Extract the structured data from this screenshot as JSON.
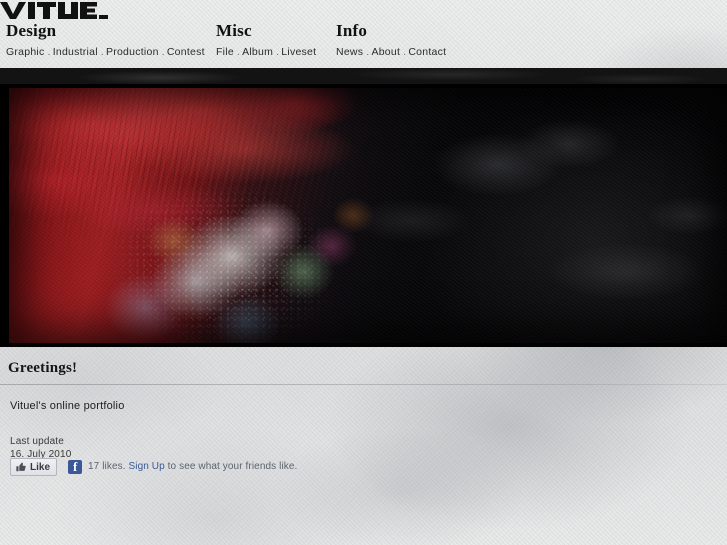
{
  "site": {
    "logo_text": "VITUEL",
    "logo_alt": "vituel-wordmark"
  },
  "nav": {
    "columns": [
      {
        "title": "Design",
        "items": [
          "Graphic",
          "Industrial",
          "Production",
          "Contest"
        ]
      },
      {
        "title": "Misc",
        "items": [
          "File",
          "Album",
          "Liveset"
        ]
      },
      {
        "title": "Info",
        "items": [
          "News",
          "About",
          "Contact"
        ]
      }
    ],
    "separator": "."
  },
  "hero": {
    "alt": "abstract-red-and-black-digital-painting"
  },
  "content": {
    "heading": "Greetings!",
    "lede": "Vituel's online portfolio",
    "meta_label": "Last update",
    "meta_date": "16. July 2010"
  },
  "facebook": {
    "like_label": "Like",
    "badge_letter": "f",
    "count_text": "17 likes.",
    "signup_label": "Sign Up",
    "tail_text": "to see what your friends like."
  },
  "colors": {
    "page_bg": "#e2e3e3",
    "hero_bg": "#0a0a0a",
    "text": "#1c1c1c",
    "fb_blue": "#3b5998",
    "art_red": "#c02225"
  }
}
